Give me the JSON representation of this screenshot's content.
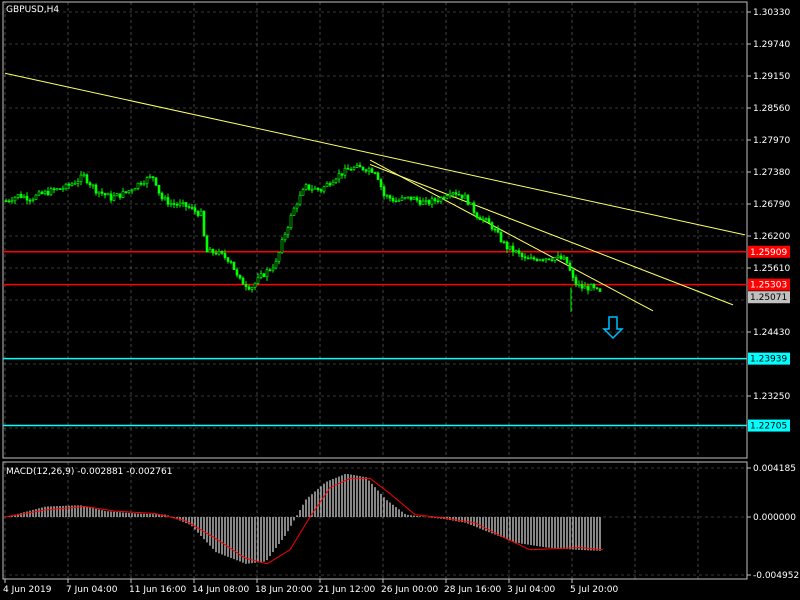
{
  "header": {
    "symbol": "GBPUSD,H4"
  },
  "macd": {
    "title": "MACD(12,26,9) -0.002881 -0.002761"
  },
  "price_axis": {
    "ticks": [
      "1.30330",
      "1.29740",
      "1.29150",
      "1.28560",
      "1.27970",
      "1.27380",
      "1.26790",
      "1.26200",
      "1.25610",
      "1.24430",
      "1.23250"
    ],
    "markers": [
      {
        "label": "1.25909",
        "color": "#ff0000",
        "text_color": "#ffffff"
      },
      {
        "label": "1.25303",
        "color": "#ff0000",
        "text_color": "#ffffff"
      },
      {
        "label": "1.25071",
        "color": "#c0c0c0",
        "text_color": "#000000"
      },
      {
        "label": "1.23939",
        "color": "#00ffff",
        "text_color": "#000000"
      },
      {
        "label": "1.22705",
        "color": "#00ffff",
        "text_color": "#000000"
      }
    ]
  },
  "macd_axis": {
    "ticks": [
      "0.004185",
      "0.000000",
      "-0.004952"
    ]
  },
  "time_axis": {
    "labels": [
      "4 Jun 2019",
      "7 Jun 04:00",
      "11 Jun 16:00",
      "14 Jun 08:00",
      "18 Jun 20:00",
      "21 Jun 12:00",
      "26 Jun 00:00",
      "28 Jun 16:00",
      "3 Jul 04:00",
      "5 Jul 20:00"
    ]
  },
  "colors": {
    "background": "#000000",
    "grid": "#c0c0c0",
    "candle": "#00ff00",
    "resistance": "#ff0000",
    "support": "#00ffff",
    "trendline": "#ffff66",
    "macd_hist": "#c0c0c0",
    "macd_signal": "#ff0000",
    "arrow": "#00bfff"
  },
  "chart_data": {
    "type": "candlestick",
    "title": "GBPUSD,H4",
    "y_range": [
      1.227,
      1.3033
    ],
    "levels": [
      {
        "price": 1.25909,
        "color": "red"
      },
      {
        "price": 1.25303,
        "color": "red"
      },
      {
        "price": 1.23939,
        "color": "cyan"
      },
      {
        "price": 1.22705,
        "color": "cyan"
      }
    ],
    "last_price": 1.25071,
    "close_path": [
      [
        0,
        1.2685
      ],
      [
        12,
        1.2695
      ],
      [
        25,
        1.269
      ],
      [
        40,
        1.27
      ],
      [
        60,
        1.271
      ],
      [
        78,
        1.273
      ],
      [
        90,
        1.2705
      ],
      [
        105,
        1.269
      ],
      [
        120,
        1.27
      ],
      [
        135,
        1.272
      ],
      [
        148,
        1.273
      ],
      [
        155,
        1.269
      ],
      [
        165,
        1.268
      ],
      [
        180,
        1.2675
      ],
      [
        195,
        1.266
      ],
      [
        200,
        1.259
      ],
      [
        210,
        1.259
      ],
      [
        225,
        1.2575
      ],
      [
        232,
        1.254
      ],
      [
        245,
        1.2525
      ],
      [
        255,
        1.2545
      ],
      [
        270,
        1.257
      ],
      [
        278,
        1.262
      ],
      [
        290,
        1.268
      ],
      [
        300,
        1.271
      ],
      [
        315,
        1.2705
      ],
      [
        330,
        1.273
      ],
      [
        345,
        1.2745
      ],
      [
        360,
        1.2745
      ],
      [
        370,
        1.274
      ],
      [
        378,
        1.2695
      ],
      [
        390,
        1.2685
      ],
      [
        405,
        1.269
      ],
      [
        420,
        1.268
      ],
      [
        435,
        1.269
      ],
      [
        445,
        1.2705
      ],
      [
        460,
        1.269
      ],
      [
        470,
        1.266
      ],
      [
        485,
        1.264
      ],
      [
        500,
        1.26
      ],
      [
        510,
        1.259
      ],
      [
        520,
        1.2575
      ],
      [
        535,
        1.258
      ],
      [
        550,
        1.258
      ],
      [
        560,
        1.2575
      ],
      [
        568,
        1.2535
      ],
      [
        575,
        1.2525
      ],
      [
        585,
        1.2525
      ],
      [
        600,
        1.2507
      ]
    ],
    "macd_histogram": [
      [
        0,
        0.0
      ],
      [
        40,
        0.0009
      ],
      [
        75,
        0.001
      ],
      [
        100,
        0.0005
      ],
      [
        130,
        0.0003
      ],
      [
        160,
        0.0002
      ],
      [
        185,
        -0.0007
      ],
      [
        210,
        -0.003
      ],
      [
        240,
        -0.004
      ],
      [
        260,
        -0.0038
      ],
      [
        280,
        -0.0015
      ],
      [
        300,
        0.0015
      ],
      [
        320,
        0.003
      ],
      [
        340,
        0.0037
      ],
      [
        360,
        0.0034
      ],
      [
        380,
        0.0015
      ],
      [
        400,
        0.0002
      ],
      [
        420,
        0.0
      ],
      [
        440,
        -0.0002
      ],
      [
        460,
        -0.0005
      ],
      [
        480,
        -0.0012
      ],
      [
        510,
        -0.0022
      ],
      [
        540,
        -0.0026
      ],
      [
        570,
        -0.0028
      ],
      [
        598,
        -0.0029
      ]
    ],
    "macd_signal": [
      [
        0,
        0.0
      ],
      [
        40,
        0.0006
      ],
      [
        80,
        0.0009
      ],
      [
        110,
        0.0005
      ],
      [
        150,
        0.0003
      ],
      [
        180,
        -0.0003
      ],
      [
        210,
        -0.0018
      ],
      [
        240,
        -0.0035
      ],
      [
        262,
        -0.004
      ],
      [
        285,
        -0.0028
      ],
      [
        305,
        0.0
      ],
      [
        325,
        0.0025
      ],
      [
        345,
        0.0033
      ],
      [
        365,
        0.0033
      ],
      [
        385,
        0.002
      ],
      [
        410,
        0.0002
      ],
      [
        440,
        -0.0001
      ],
      [
        470,
        -0.0005
      ],
      [
        500,
        -0.0018
      ],
      [
        525,
        -0.0028
      ],
      [
        550,
        -0.0027
      ],
      [
        575,
        -0.0026
      ],
      [
        598,
        -0.0028
      ]
    ]
  }
}
